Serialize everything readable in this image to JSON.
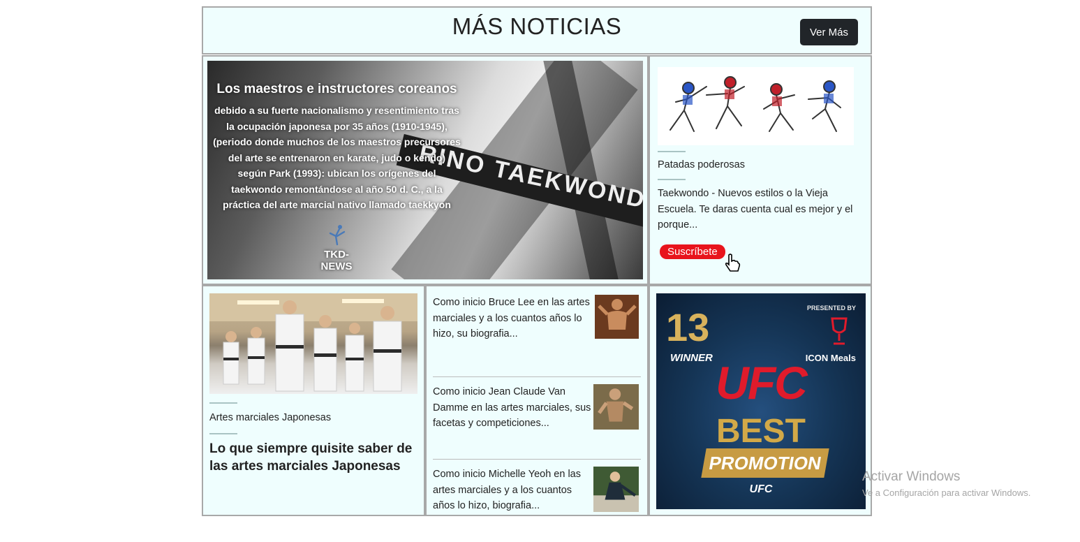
{
  "header": {
    "title": "MÁS NOTICIAS",
    "button": "Ver Más"
  },
  "hero": {
    "belt_text": "RINO TAEKWONDO",
    "title": "Los maestros e instructores coreanos",
    "body": "debido a su fuerte nacionalismo y resentimiento tras la ocupación japonesa por 35 años (1910-1945), (periodo donde muchos de los maestros precursores del arte se entrenaron en karate, judo o kendo) según Park (1993): ubican los orígenes del taekwondo remontándose al año 50 d. C., a la práctica del arte marcial nativo llamado taekkyon",
    "brand": "TKD-NEWS"
  },
  "right_top": {
    "category": "Patadas poderosas",
    "description": "Taekwondo - Nuevos estilos o la Vieja Escuela. Te daras cuenta cual es mejor y el porque...",
    "subscribe": "Suscríbete"
  },
  "bottom_left": {
    "category": "Artes marciales Japonesas",
    "headline": "Lo que siempre quisite saber de las artes marciales Japonesas"
  },
  "bottom_middle": {
    "items": [
      {
        "text": "Como inicio Bruce Lee en las artes marciales y a los cuantos años lo hizo, su biografia..."
      },
      {
        "text": "Como inicio Jean Claude Van Damme en las artes marciales, sus facetas y competiciones..."
      },
      {
        "text": "Como inicio Michelle Yeoh en las artes marciales y a los cuantos años lo hizo, biografia..."
      }
    ]
  },
  "ad": {
    "number": "13",
    "winner": "WINNER",
    "presented": "PRESENTED BY",
    "sponsor": "ICON Meals",
    "logo": "UFC",
    "best": "BEST",
    "promotion": "PROMOTION",
    "footer": "UFC"
  },
  "watermark": {
    "line1": "Activar Windows",
    "line2": "Ve a Configuración para activar Windows."
  }
}
